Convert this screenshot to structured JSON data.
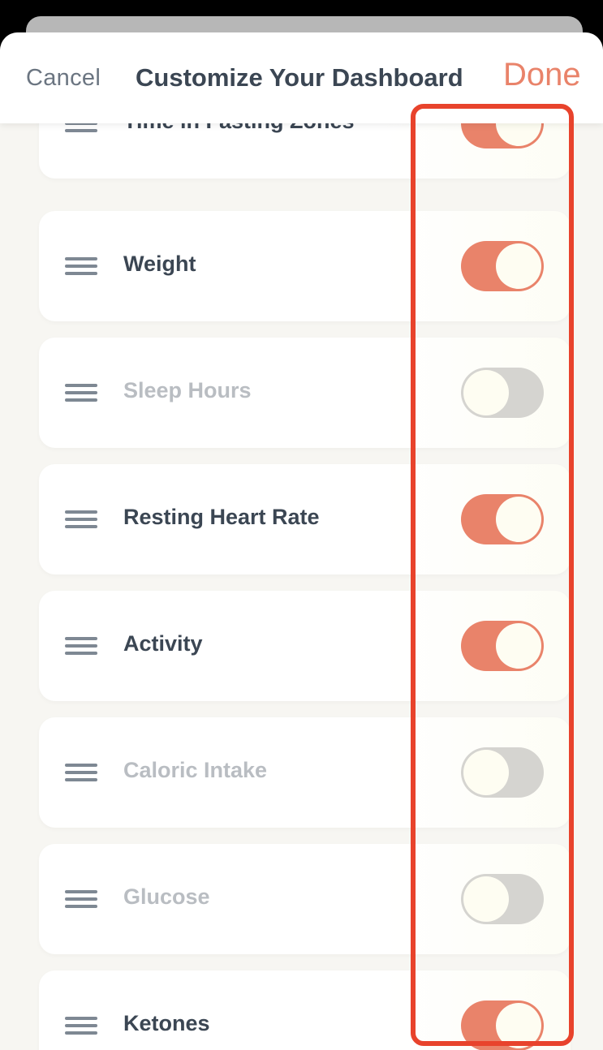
{
  "header": {
    "cancel_label": "Cancel",
    "title": "Customize Your Dashboard",
    "done_label": "Done"
  },
  "items": [
    {
      "label": "Time in Fasting Zones",
      "enabled": true
    },
    {
      "label": "Weight",
      "enabled": true
    },
    {
      "label": "Sleep Hours",
      "enabled": false
    },
    {
      "label": "Resting Heart Rate",
      "enabled": true
    },
    {
      "label": "Activity",
      "enabled": true
    },
    {
      "label": "Caloric Intake",
      "enabled": false
    },
    {
      "label": "Glucose",
      "enabled": false
    },
    {
      "label": "Ketones",
      "enabled": true
    }
  ],
  "colors": {
    "accent": "#e9836a",
    "toggle_off": "#d5d4d0",
    "highlight": "#e8432c",
    "text_active": "#3b4653",
    "text_inactive": "#b9bdc2"
  },
  "icons": {
    "drag_handle": "drag-handle-icon"
  }
}
